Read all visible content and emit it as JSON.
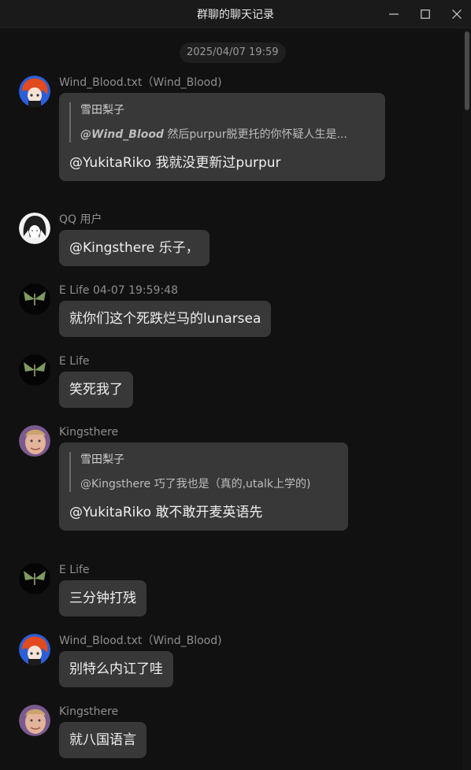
{
  "window": {
    "title": "群聊的聊天记录",
    "min_glyph": "—",
    "max_glyph": "☐",
    "close_glyph": "✕"
  },
  "timestamp": "2025/04/07 19:59",
  "messages": [
    {
      "sender": "Wind_Blood.txt（Wind_Blood)",
      "avatar": "red-hair-anime-avatar",
      "quote_name": "雪田梨子",
      "quote_mention": "@Wind_Blood",
      "quote_text": "然后purpur脱更托的你怀疑人生是...",
      "text": "@YukitaRiko 我就没更新过purpur"
    },
    {
      "sender": "QQ 用户",
      "avatar": "manga-girl-avatar",
      "text": "@Kingsthere 乐子，"
    },
    {
      "sender": "E Life 04-07 19:59:48",
      "avatar": "green-moth-avatar",
      "text": "就你们这个死跌烂马的lunarsea"
    },
    {
      "sender": "E Life",
      "avatar": "green-moth-avatar",
      "text": "笑死我了"
    },
    {
      "sender": "Kingsthere",
      "avatar": "face-photo-avatar",
      "quote_name": "雪田梨子",
      "quote_text": "@Kingsthere 巧了我也是（真的,utalk上学的)",
      "text": "@YukitaRiko 敢不敢开麦英语先"
    },
    {
      "sender": "E Life",
      "avatar": "green-moth-avatar",
      "text": "三分钟打残"
    },
    {
      "sender": "Wind_Blood.txt（Wind_Blood)",
      "avatar": "red-hair-anime-avatar",
      "text": "别特么内讧了哇"
    },
    {
      "sender": "Kingsthere",
      "avatar": "face-photo-avatar",
      "text": "就八国语言"
    }
  ]
}
